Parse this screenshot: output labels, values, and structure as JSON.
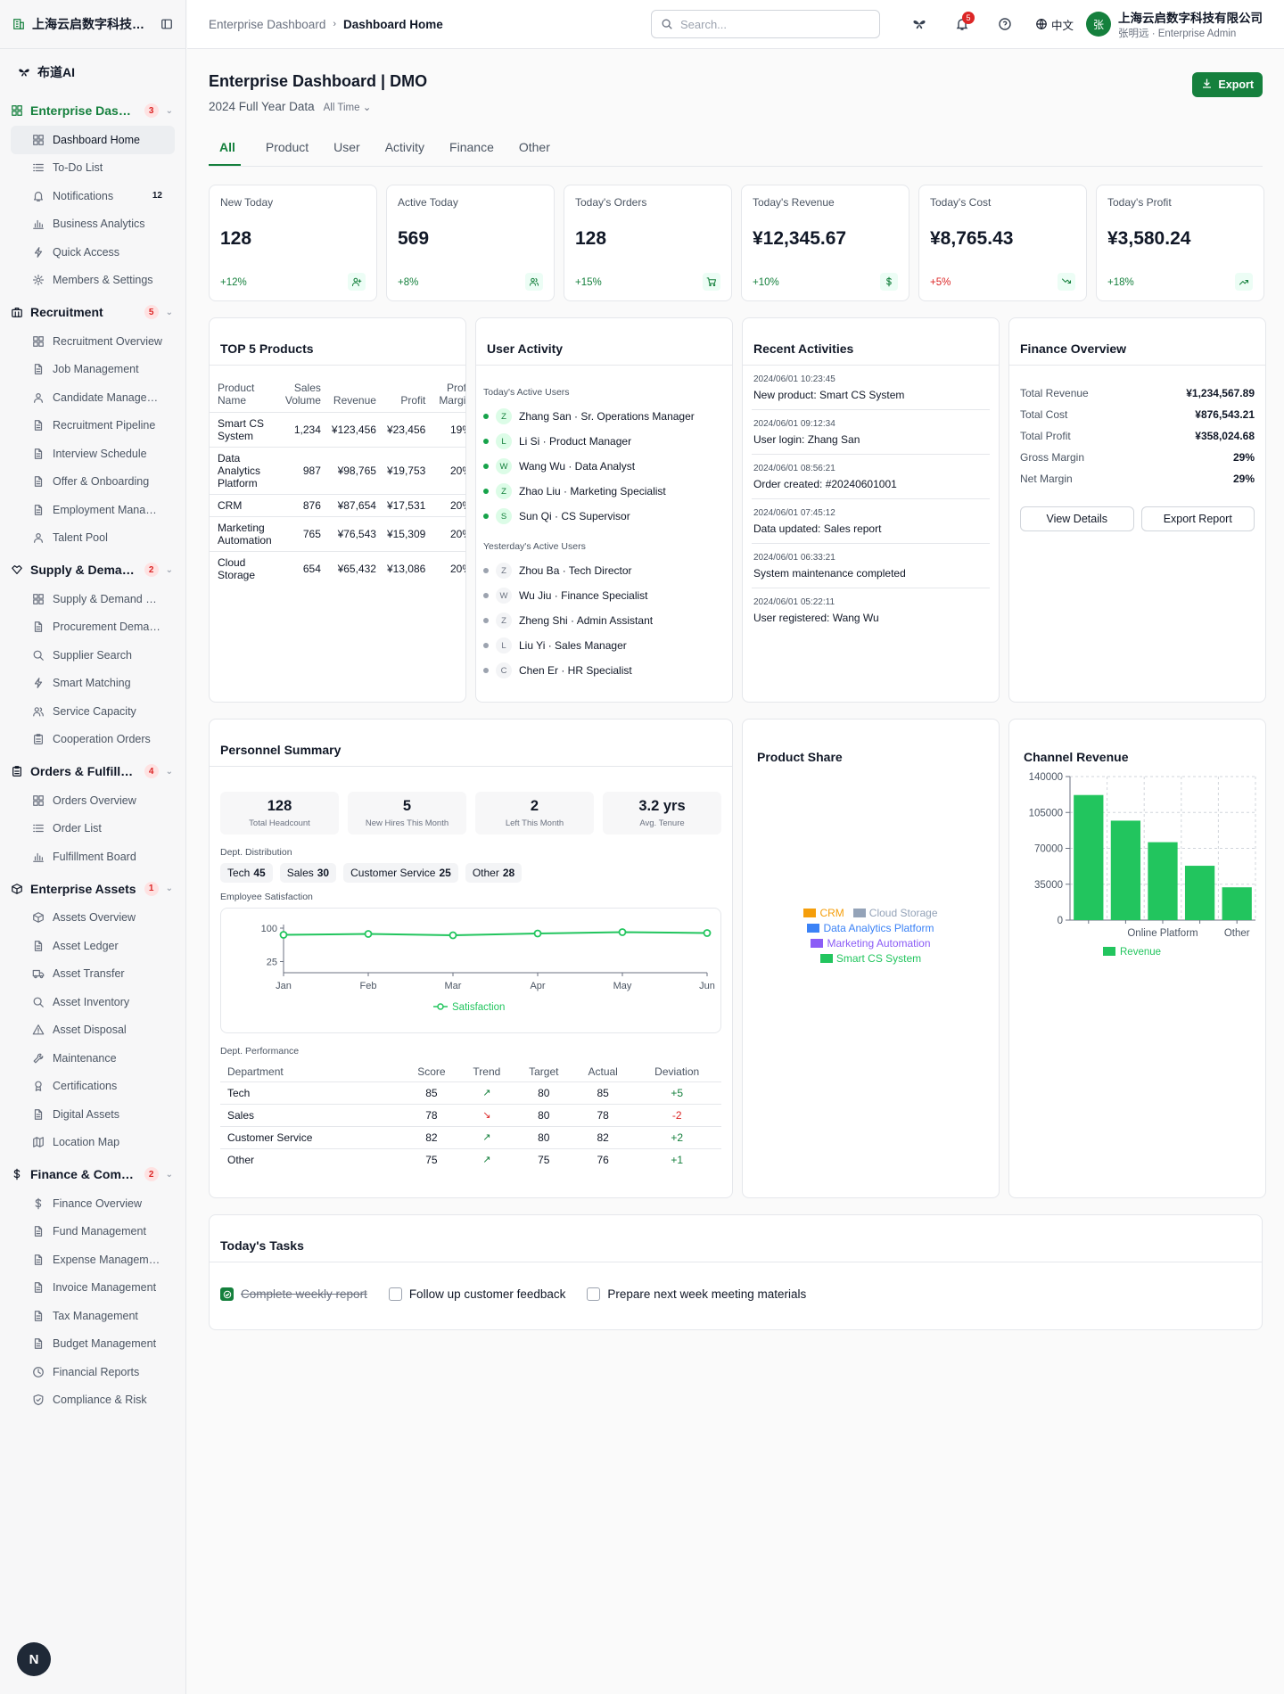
{
  "sidebar": {
    "org_name": "上海云启数字科技有限公司",
    "brand": "布道AI",
    "groups": [
      {
        "label": "Enterprise Dashboard",
        "badge": "3",
        "icon": "dashboard-icon",
        "active": true,
        "items": [
          {
            "label": "Dashboard Home",
            "icon": "grid-icon",
            "active": true
          },
          {
            "label": "To-Do List",
            "icon": "list-icon"
          },
          {
            "label": "Notifications",
            "icon": "bell-icon",
            "count": "12"
          },
          {
            "label": "Business Analytics",
            "icon": "bar-chart-icon"
          },
          {
            "label": "Quick Access",
            "icon": "lightning-icon"
          },
          {
            "label": "Members & Settings",
            "icon": "gear-icon"
          }
        ]
      },
      {
        "label": "Recruitment",
        "badge": "5",
        "icon": "briefcase-icon",
        "items": [
          {
            "label": "Recruitment Overview",
            "icon": "grid-icon"
          },
          {
            "label": "Job Management",
            "icon": "document-icon"
          },
          {
            "label": "Candidate Management",
            "icon": "user-icon"
          },
          {
            "label": "Recruitment Pipeline",
            "icon": "document-icon"
          },
          {
            "label": "Interview Schedule",
            "icon": "document-icon"
          },
          {
            "label": "Offer & Onboarding",
            "icon": "document-icon"
          },
          {
            "label": "Employment Management",
            "icon": "document-icon"
          },
          {
            "label": "Talent Pool",
            "icon": "user-icon"
          }
        ]
      },
      {
        "label": "Supply & Demand",
        "badge": "2",
        "icon": "handshake-icon",
        "items": [
          {
            "label": "Supply & Demand Market",
            "icon": "grid-icon"
          },
          {
            "label": "Procurement Demands",
            "icon": "document-icon"
          },
          {
            "label": "Supplier Search",
            "icon": "search-icon"
          },
          {
            "label": "Smart Matching",
            "icon": "lightning-icon"
          },
          {
            "label": "Service Capacity",
            "icon": "users-icon"
          },
          {
            "label": "Cooperation Orders",
            "icon": "clipboard-icon"
          }
        ]
      },
      {
        "label": "Orders & Fulfillment",
        "badge": "4",
        "icon": "clipboard-icon",
        "items": [
          {
            "label": "Orders Overview",
            "icon": "grid-icon"
          },
          {
            "label": "Order List",
            "icon": "list-icon"
          },
          {
            "label": "Fulfillment Board",
            "icon": "bar-chart-icon"
          }
        ]
      },
      {
        "label": "Enterprise Assets",
        "badge": "1",
        "icon": "box-icon",
        "items": [
          {
            "label": "Assets Overview",
            "icon": "box-icon"
          },
          {
            "label": "Asset Ledger",
            "icon": "document-icon"
          },
          {
            "label": "Asset Transfer",
            "icon": "truck-icon"
          },
          {
            "label": "Asset Inventory",
            "icon": "search-icon"
          },
          {
            "label": "Asset Disposal",
            "icon": "warning-icon"
          },
          {
            "label": "Maintenance",
            "icon": "wrench-icon"
          },
          {
            "label": "Certifications",
            "icon": "award-icon"
          },
          {
            "label": "Digital Assets",
            "icon": "document-icon"
          },
          {
            "label": "Location Map",
            "icon": "map-icon"
          }
        ]
      },
      {
        "label": "Finance & Compliance",
        "badge": "2",
        "icon": "dollar-icon",
        "items": [
          {
            "label": "Finance Overview",
            "icon": "dollar-icon"
          },
          {
            "label": "Fund Management",
            "icon": "document-icon"
          },
          {
            "label": "Expense Management",
            "icon": "document-icon"
          },
          {
            "label": "Invoice Management",
            "icon": "document-icon"
          },
          {
            "label": "Tax Management",
            "icon": "document-icon"
          },
          {
            "label": "Budget Management",
            "icon": "document-icon"
          },
          {
            "label": "Financial Reports",
            "icon": "clock-icon"
          },
          {
            "label": "Compliance & Risk",
            "icon": "shield-icon"
          }
        ]
      }
    ],
    "fab": "N"
  },
  "topbar": {
    "crumbs": [
      "Enterprise Dashboard",
      "Dashboard Home"
    ],
    "search_placeholder": "Search...",
    "notif_count": "5",
    "lang": "中文",
    "user_name": "上海云启数字科技有限公司",
    "user_role": "张明远 · Enterprise Admin",
    "avatar": "张"
  },
  "page": {
    "title": "Enterprise Dashboard | DMO",
    "subtitle": "2024 Full Year Data",
    "range": "All Time",
    "export_label": "Export",
    "tabs": [
      "All",
      "Product",
      "User",
      "Activity",
      "Finance",
      "Other"
    ]
  },
  "kpis": [
    {
      "label": "New Today",
      "value": "128",
      "change": "+12%",
      "icon": "user-plus-icon"
    },
    {
      "label": "Active Today",
      "value": "569",
      "change": "+8%",
      "icon": "users-icon"
    },
    {
      "label": "Today's Orders",
      "value": "128",
      "change": "+15%",
      "icon": "cart-icon"
    },
    {
      "label": "Today's Revenue",
      "value": "¥12,345.67",
      "change": "+10%",
      "icon": "dollar-icon"
    },
    {
      "label": "Today's Cost",
      "value": "¥8,765.43",
      "change": "+5%",
      "icon": "trend-down-icon",
      "negative": true
    },
    {
      "label": "Today's Profit",
      "value": "¥3,580.24",
      "change": "+18%",
      "icon": "trend-up-icon"
    }
  ],
  "top_products": {
    "title": "TOP 5 Products",
    "headers": [
      "Product Name",
      "Sales Volume",
      "Revenue",
      "Profit",
      "Profit Margin"
    ],
    "rows": [
      [
        "Smart CS System",
        "1,234",
        "¥123,456",
        "¥23,456",
        "19%"
      ],
      [
        "Data Analytics Platform",
        "987",
        "¥98,765",
        "¥19,753",
        "20%"
      ],
      [
        "CRM",
        "876",
        "¥87,654",
        "¥17,531",
        "20%"
      ],
      [
        "Marketing Automation",
        "765",
        "¥76,543",
        "¥15,309",
        "20%"
      ],
      [
        "Cloud Storage",
        "654",
        "¥65,432",
        "¥13,086",
        "20%"
      ]
    ]
  },
  "user_activity": {
    "title": "User Activity",
    "today_label": "Today's Active Users",
    "today": [
      {
        "i": "Z",
        "text": "Zhang San · Sr. Operations Manager"
      },
      {
        "i": "L",
        "text": "Li Si · Product Manager"
      },
      {
        "i": "W",
        "text": "Wang Wu · Data Analyst"
      },
      {
        "i": "Z",
        "text": "Zhao Liu · Marketing Specialist"
      },
      {
        "i": "S",
        "text": "Sun Qi · CS Supervisor"
      }
    ],
    "yesterday_label": "Yesterday's Active Users",
    "yesterday": [
      {
        "i": "Z",
        "text": "Zhou Ba · Tech Director"
      },
      {
        "i": "W",
        "text": "Wu Jiu · Finance Specialist"
      },
      {
        "i": "Z",
        "text": "Zheng Shi · Admin Assistant"
      },
      {
        "i": "L",
        "text": "Liu Yi · Sales Manager"
      },
      {
        "i": "C",
        "text": "Chen Er · HR Specialist"
      }
    ]
  },
  "recent_activities": {
    "title": "Recent Activities",
    "items": [
      {
        "time": "2024/06/01 10:23:45",
        "desc": "New product: Smart CS System"
      },
      {
        "time": "2024/06/01 09:12:34",
        "desc": "User login: Zhang San"
      },
      {
        "time": "2024/06/01 08:56:21",
        "desc": "Order created: #20240601001"
      },
      {
        "time": "2024/06/01 07:45:12",
        "desc": "Data updated: Sales report"
      },
      {
        "time": "2024/06/01 06:33:21",
        "desc": "System maintenance completed"
      },
      {
        "time": "2024/06/01 05:22:11",
        "desc": "User registered: Wang Wu"
      }
    ]
  },
  "finance": {
    "title": "Finance Overview",
    "rows": [
      {
        "label": "Total Revenue",
        "value": "¥1,234,567.89"
      },
      {
        "label": "Total Cost",
        "value": "¥876,543.21"
      },
      {
        "label": "Total Profit",
        "value": "¥358,024.68"
      },
      {
        "label": "Gross Margin",
        "value": "29%"
      },
      {
        "label": "Net Margin",
        "value": "29%"
      }
    ],
    "btn_details": "View Details",
    "btn_report": "Export Report"
  },
  "personnel": {
    "title": "Personnel Summary",
    "stats": [
      {
        "value": "128",
        "label": "Total Headcount"
      },
      {
        "value": "5",
        "label": "New Hires This Month"
      },
      {
        "value": "2",
        "label": "Left This Month"
      },
      {
        "value": "3.2 yrs",
        "label": "Avg. Tenure"
      }
    ],
    "dist_label": "Dept. Distribution",
    "dist": [
      {
        "name": "Tech",
        "count": "45"
      },
      {
        "name": "Sales",
        "count": "30"
      },
      {
        "name": "Customer Service",
        "count": "25"
      },
      {
        "name": "Other",
        "count": "28"
      }
    ],
    "sat_label": "Employee Satisfaction",
    "perf_label": "Dept. Performance",
    "perf_headers": [
      "Department",
      "Score",
      "Trend",
      "Target",
      "Actual",
      "Deviation"
    ],
    "perf_rows": [
      {
        "dept": "Tech",
        "score": "85",
        "trend": "up",
        "target": "80",
        "actual": "85",
        "dev": "+5"
      },
      {
        "dept": "Sales",
        "score": "78",
        "trend": "down",
        "target": "80",
        "actual": "78",
        "dev": "-2"
      },
      {
        "dept": "Customer Service",
        "score": "82",
        "trend": "up",
        "target": "80",
        "actual": "82",
        "dev": "+2"
      },
      {
        "dept": "Other",
        "score": "75",
        "trend": "up",
        "target": "75",
        "actual": "76",
        "dev": "+1"
      }
    ]
  },
  "product_share": {
    "title": "Product Share",
    "legend": [
      {
        "name": "CRM",
        "color": "#f59e0b"
      },
      {
        "name": "Cloud Storage",
        "color": "#94a3b8"
      },
      {
        "name": "Data Analytics Platform",
        "color": "#3b82f6"
      },
      {
        "name": "Marketing Automation",
        "color": "#8b5cf6"
      },
      {
        "name": "Smart CS System",
        "color": "#22c55e"
      }
    ]
  },
  "channel_revenue": {
    "title": "Channel Revenue"
  },
  "tasks": {
    "title": "Today's Tasks",
    "items": [
      {
        "label": "Complete weekly report",
        "done": true
      },
      {
        "label": "Follow up customer feedback",
        "done": false
      },
      {
        "label": "Prepare next week meeting materials",
        "done": false
      }
    ]
  },
  "chart_data": [
    {
      "type": "line",
      "x": [
        "Jan",
        "Feb",
        "Mar",
        "Apr",
        "May",
        "Jun"
      ],
      "series": [
        {
          "name": "Satisfaction",
          "values": [
            85,
            87,
            84,
            88,
            91,
            89
          ]
        }
      ],
      "yticks": [
        25,
        100
      ],
      "ylim": [
        0,
        100
      ],
      "color": "#22c55e"
    },
    {
      "type": "bar",
      "categories": [
        "",
        "",
        "Online Platform",
        "",
        "Other"
      ],
      "series": [
        {
          "name": "Revenue",
          "values": [
            122000,
            97000,
            76000,
            53000,
            32000
          ]
        }
      ],
      "yticks": [
        0,
        35000,
        70000,
        105000,
        140000
      ],
      "ylim": [
        0,
        140000
      ],
      "color": "#22c55e"
    }
  ]
}
